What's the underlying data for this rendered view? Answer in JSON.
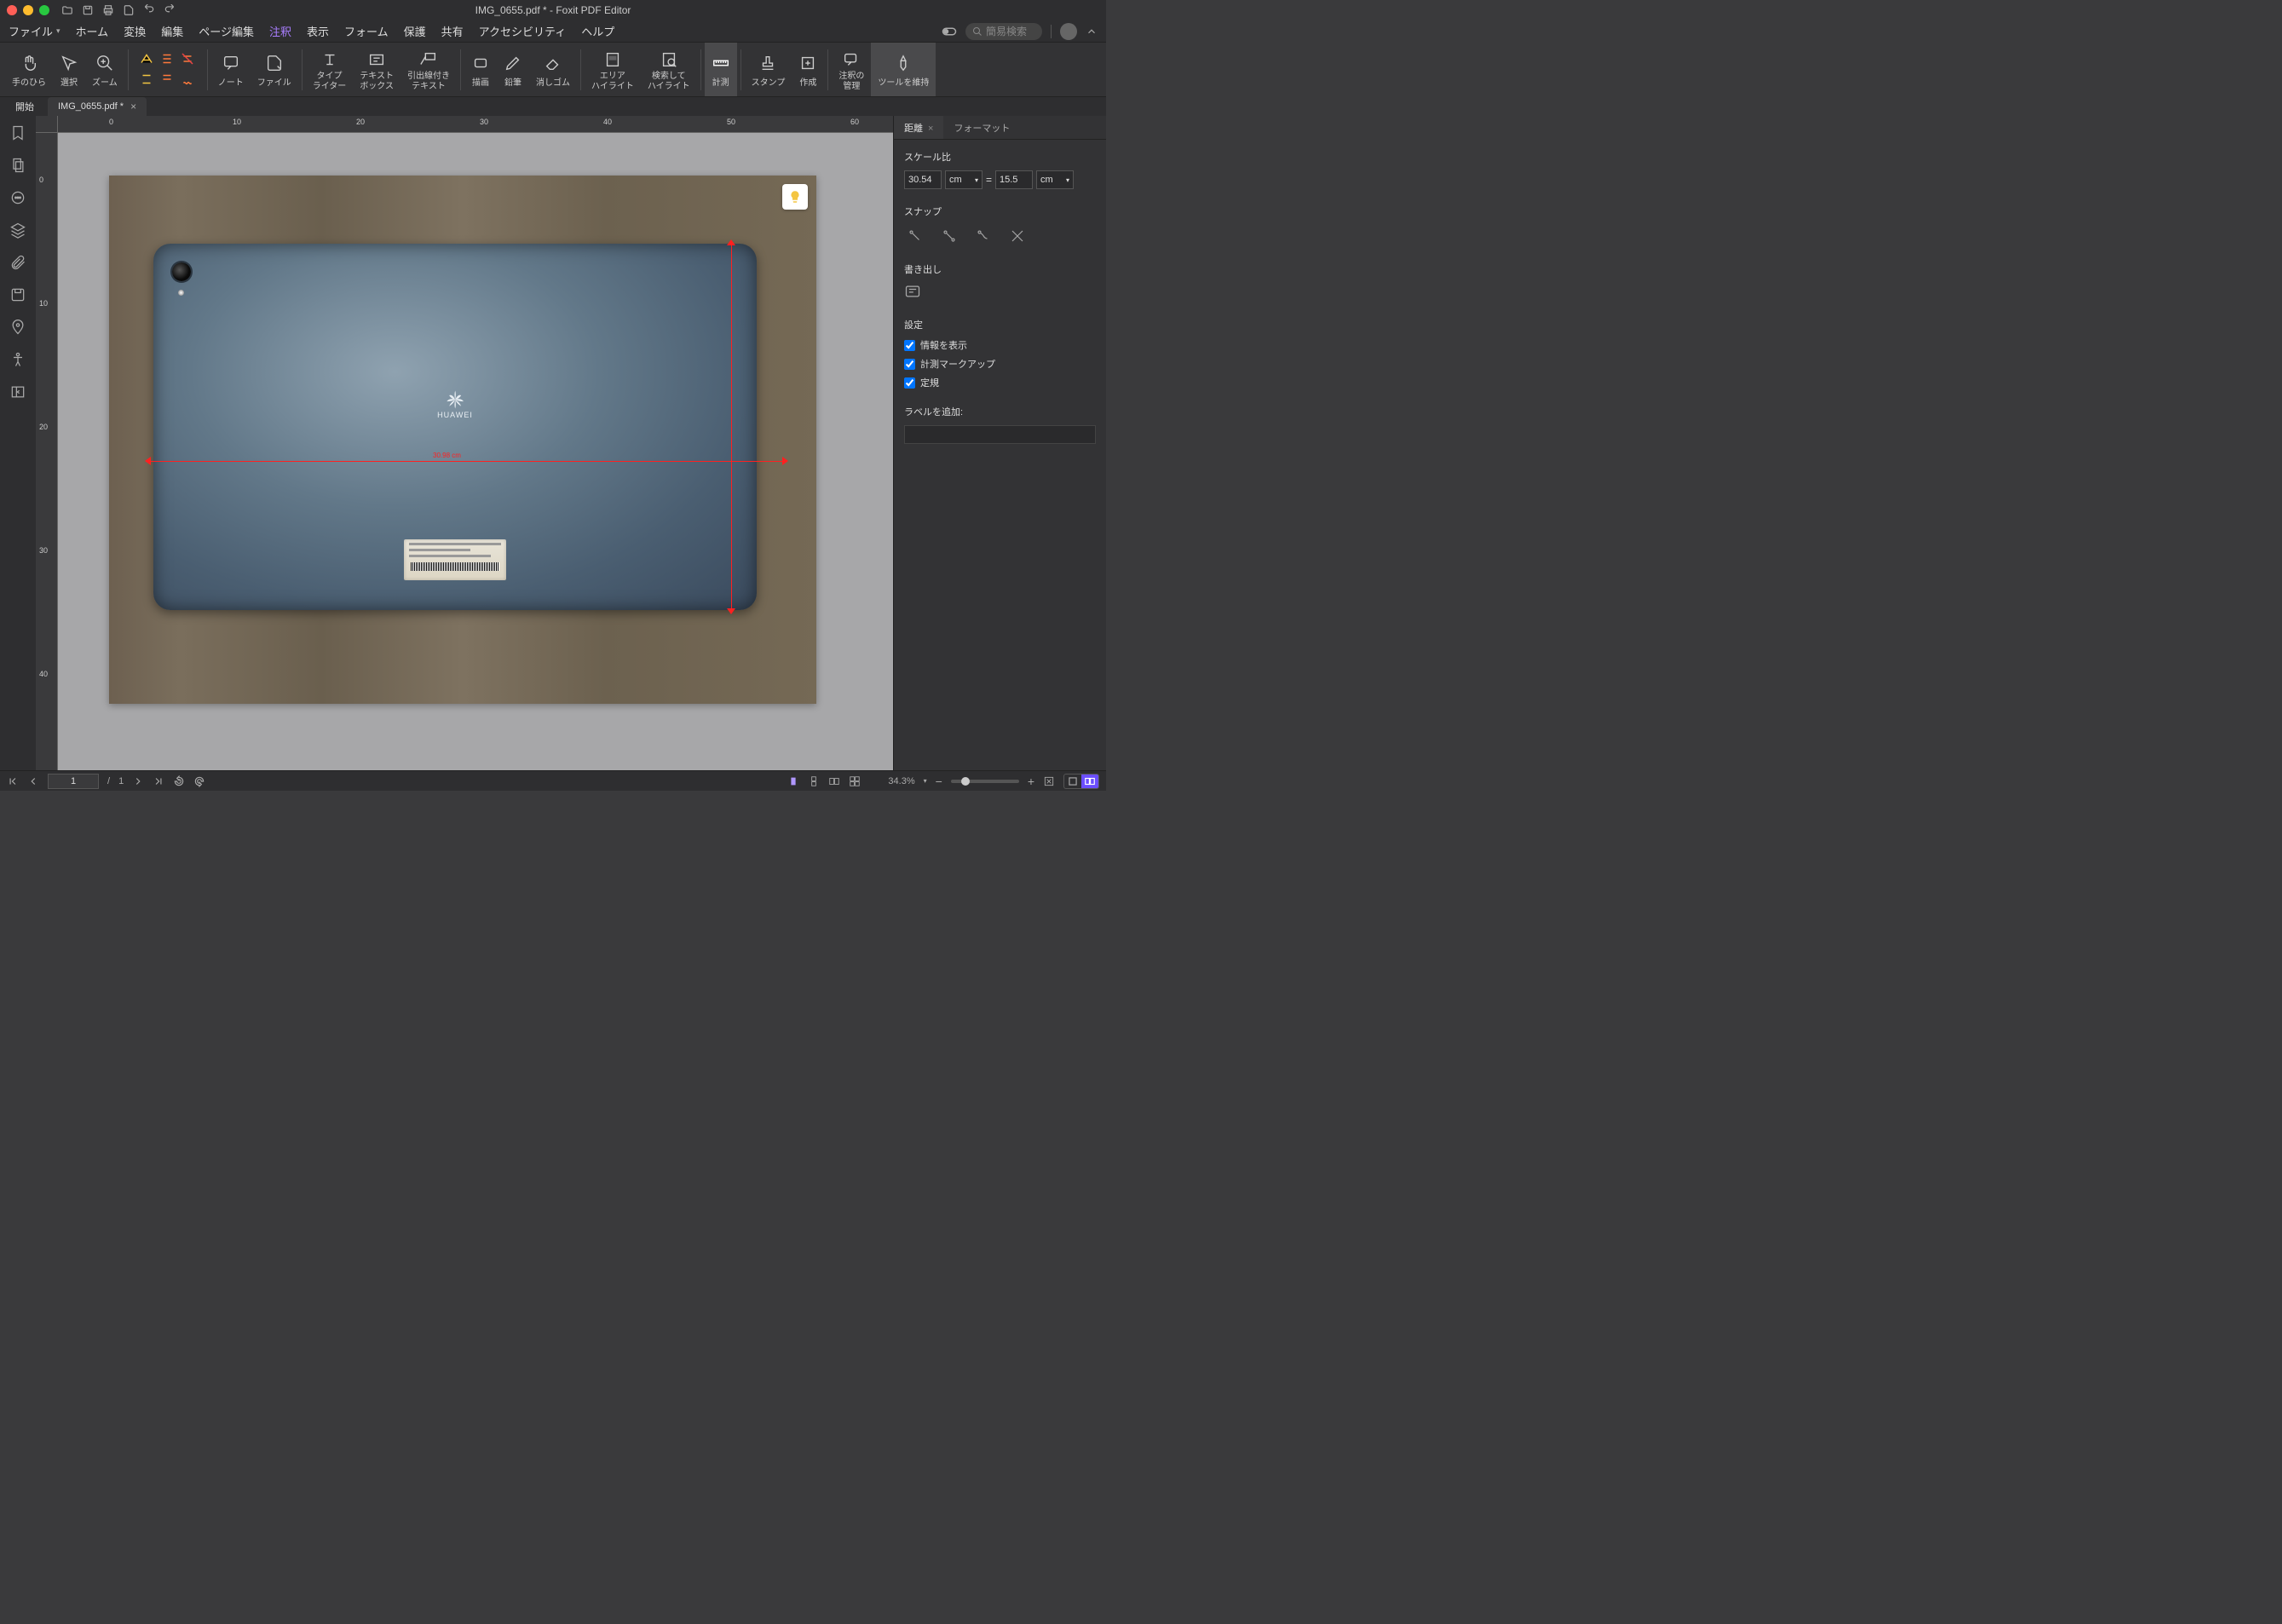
{
  "window": {
    "title": "IMG_0655.pdf * - Foxit PDF Editor"
  },
  "menubar": {
    "items": [
      "ファイル",
      "ホーム",
      "変換",
      "編集",
      "ページ編集",
      "注釈",
      "表示",
      "フォーム",
      "保護",
      "共有",
      "アクセシビリティ",
      "ヘルプ"
    ],
    "active_index": 5,
    "search_placeholder": "簡易検索"
  },
  "ribbon": {
    "groups": [
      {
        "label": "手のひら"
      },
      {
        "label": "選択"
      },
      {
        "label": "ズーム"
      },
      {
        "label": ""
      },
      {
        "label": "ノート"
      },
      {
        "label": "ファイル"
      },
      {
        "label": "タイプ\nライター"
      },
      {
        "label": "テキスト\nボックス"
      },
      {
        "label": "引出線付き\nテキスト"
      },
      {
        "label": "描画"
      },
      {
        "label": "鉛筆"
      },
      {
        "label": "消しゴム"
      },
      {
        "label": "エリア\nハイライト"
      },
      {
        "label": "検索して\nハイライト"
      },
      {
        "label": "計測"
      },
      {
        "label": "スタンプ"
      },
      {
        "label": "作成"
      },
      {
        "label": "注釈の\n管理"
      },
      {
        "label": "ツールを維持"
      }
    ],
    "active_index": 14
  },
  "tabs": {
    "start": "開始",
    "doc": "IMG_0655.pdf *"
  },
  "ruler": {
    "h_ticks": [
      "0",
      "10",
      "20",
      "30",
      "40",
      "50",
      "60"
    ],
    "v_ticks": [
      "0",
      "10",
      "20",
      "30",
      "40"
    ]
  },
  "canvas": {
    "tablet_brand": "HUAWEI",
    "measure_label": "30.98 cm"
  },
  "right_panel": {
    "tabs": [
      {
        "label": "距離",
        "closable": true
      },
      {
        "label": "フォーマット",
        "closable": false
      }
    ],
    "active_tab": 0,
    "scale": {
      "title": "スケール比",
      "val1": "30.54",
      "unit1": "cm",
      "eq": "=",
      "val2": "15.5",
      "unit2": "cm"
    },
    "snap": {
      "title": "スナップ"
    },
    "export": {
      "title": "書き出し"
    },
    "settings": {
      "title": "設定",
      "checks": [
        "情報を表示",
        "計測マークアップ",
        "定規"
      ]
    },
    "label": {
      "title": "ラベルを追加:",
      "value": ""
    }
  },
  "statusbar": {
    "page_current": "1",
    "page_sep": "/",
    "page_total": "1",
    "zoom": "34.3%"
  }
}
